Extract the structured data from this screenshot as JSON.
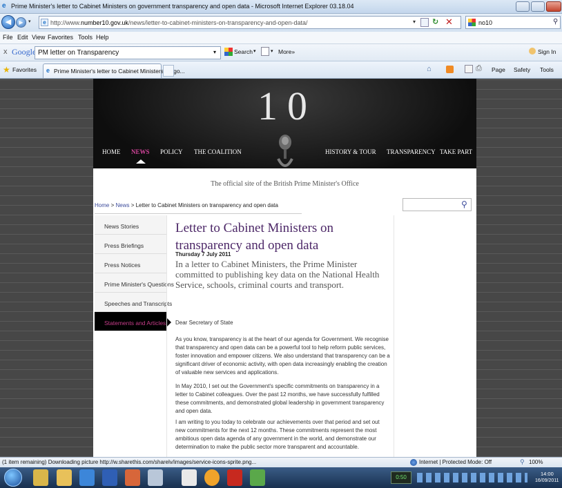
{
  "window": {
    "title": "Prime Minister's letter to Cabinet Ministers on government transparency and open data - Microsoft Internet Explorer 03.18.04"
  },
  "address": {
    "url_prefix": "http://www.",
    "url_domain": "number10.gov.uk",
    "url_path": "/news/letter-to-cabinet-ministers-on-transparency-and-open-data/",
    "search_value": "no10"
  },
  "menu": [
    "File",
    "Edit",
    "View",
    "Favorites",
    "Tools",
    "Help"
  ],
  "google_bar": {
    "close": "x",
    "logo": "Google",
    "query": "PM letter on Transparency",
    "search_label": "Search",
    "more_label": "More»",
    "sign_in": "Sign In"
  },
  "favorites_bar": {
    "favorites_label": "Favorites",
    "tab_title": "Prime Minister's letter to Cabinet Ministers on go...",
    "page_label": "Page",
    "safety_label": "Safety",
    "tools_label": "Tools"
  },
  "site": {
    "logo": "10",
    "nav": [
      "HOME",
      "NEWS",
      "POLICY",
      "THE COALITION",
      "HISTORY & TOUR",
      "TRANSPARENCY",
      "TAKE PART"
    ],
    "active_nav": "NEWS",
    "tagline": "The official site of the British Prime Minister's Office"
  },
  "breadcrumb": {
    "home": "Home",
    "sep": " > ",
    "news": "News",
    "current": "Letter to Cabinet Ministers on transparency and open data"
  },
  "sidebar": {
    "items": [
      "News Stories",
      "Press Briefings",
      "Press Notices",
      "Prime Minister's Questions",
      "Speeches and Transcripts",
      "Statements and Articles"
    ],
    "active": "Statements and Articles"
  },
  "article": {
    "title": "Letter to Cabinet Ministers on transparency and open data",
    "date": "Thursday 7 July 2011",
    "lead": "In a letter to Cabinet Ministers, the Prime Minister committed to publishing key data on the National Health Service, schools, criminal courts and transport.",
    "salutation": "Dear Secretary of State",
    "paragraphs": [
      "As you know, transparency is at the heart of our agenda for Government. We recognise that transparency and open data can be a powerful tool to help reform public services, foster innovation and empower citizens. We also understand that transparency can be a significant driver of economic activity, with open data increasingly enabling the creation of valuable new services and applications.",
      "In May 2010, I set out the Government's specific commitments on transparency in a letter to Cabinet colleagues. Over the past 12 months, we have successfully fulfilled these commitments, and demonstrated global leadership in government transparency and open data.",
      "I am writing to you today to celebrate our achievements over that period and set out new commitments for the next 12 months. These commitments represent the most ambitious open data agenda of any government in the world, and demonstrate our determination to make the public sector more transparent and accountable."
    ]
  },
  "status": {
    "text": "(1 item remaining) Downloading picture http://w.sharethis.com/sharelv/images/service-icons-sprite.png...",
    "zone": "Internet | Protected Mode: Off",
    "zoom": "100%"
  },
  "taskbar": {
    "counter": "0:50",
    "time": "14:00",
    "date": "16/09/2011"
  },
  "colors": {
    "accent_purple": "#4c2767",
    "active_pink": "#c73d8a",
    "link_blue": "#3b4a9b"
  }
}
